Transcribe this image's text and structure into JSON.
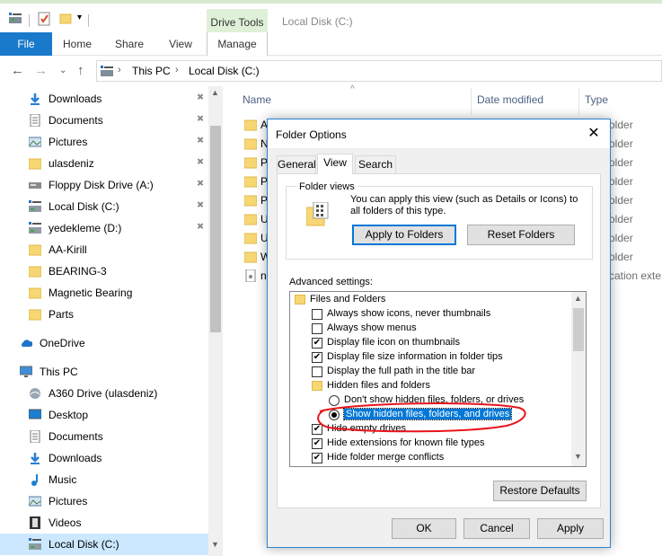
{
  "ribbon": {
    "context_group": "Drive Tools",
    "window_title": "Local Disk (C:)",
    "tabs": [
      "File",
      "Home",
      "Share",
      "View",
      "Manage"
    ]
  },
  "address": {
    "crumbs": [
      "This PC",
      "Local Disk (C:)"
    ]
  },
  "sidebar": {
    "items": [
      {
        "label": "Downloads",
        "icon": "download-arrow-icon",
        "pinned": true
      },
      {
        "label": "Documents",
        "icon": "documents-icon",
        "pinned": true
      },
      {
        "label": "Pictures",
        "icon": "pictures-icon",
        "pinned": true
      },
      {
        "label": "ulasdeniz",
        "icon": "folder-icon",
        "pinned": true
      },
      {
        "label": "Floppy Disk Drive (A:)",
        "icon": "floppy-icon",
        "pinned": true
      },
      {
        "label": "Local Disk (C:)",
        "icon": "drive-icon",
        "pinned": true
      },
      {
        "label": "yedekleme (D:)",
        "icon": "drive-icon",
        "pinned": true
      },
      {
        "label": "AA-Kirill",
        "icon": "folder-icon",
        "pinned": false
      },
      {
        "label": "BEARING-3",
        "icon": "folder-icon",
        "pinned": false
      },
      {
        "label": "Magnetic Bearing",
        "icon": "folder-icon",
        "pinned": false
      },
      {
        "label": "Parts",
        "icon": "folder-icon",
        "pinned": false
      },
      {
        "label": "OneDrive",
        "icon": "cloud-icon",
        "pinned": false
      },
      {
        "label": "This PC",
        "icon": "computer-icon",
        "pinned": false
      },
      {
        "label": "A360 Drive (ulasdeniz)",
        "icon": "a360-icon",
        "pinned": false
      },
      {
        "label": "Desktop",
        "icon": "desktop-icon",
        "pinned": false
      },
      {
        "label": "Documents",
        "icon": "documents-icon",
        "pinned": false
      },
      {
        "label": "Downloads",
        "icon": "download-arrow-icon",
        "pinned": false
      },
      {
        "label": "Music",
        "icon": "music-icon",
        "pinned": false
      },
      {
        "label": "Pictures",
        "icon": "pictures-icon",
        "pinned": false
      },
      {
        "label": "Videos",
        "icon": "videos-icon",
        "pinned": false
      },
      {
        "label": "Local Disk (C:)",
        "icon": "drive-icon",
        "pinned": false,
        "selected": true
      }
    ]
  },
  "content": {
    "columns": [
      "Name",
      "Date modified",
      "Type"
    ],
    "rows": [
      {
        "name": "A",
        "type": "older"
      },
      {
        "name": "N",
        "type": "older"
      },
      {
        "name": "P",
        "type": "older"
      },
      {
        "name": "P",
        "type": "older"
      },
      {
        "name": "P",
        "type": "older"
      },
      {
        "name": "U",
        "type": "older"
      },
      {
        "name": "U",
        "type": "older"
      },
      {
        "name": "W",
        "type": "older"
      },
      {
        "name": "n",
        "type": "cation exte"
      }
    ]
  },
  "dialog": {
    "title": "Folder Options",
    "tabs": [
      "General",
      "View",
      "Search"
    ],
    "folder_views": {
      "legend": "Folder views",
      "text": "You can apply this view (such as Details or Icons) to all folders of this type.",
      "apply_button": "Apply to Folders",
      "reset_button": "Reset Folders"
    },
    "advanced_label": "Advanced settings:",
    "advanced": [
      {
        "kind": "folder",
        "label": "Files and Folders"
      },
      {
        "kind": "check",
        "label": "Always show icons, never thumbnails",
        "checked": false
      },
      {
        "kind": "check",
        "label": "Always show menus",
        "checked": false
      },
      {
        "kind": "check",
        "label": "Display file icon on thumbnails",
        "checked": true
      },
      {
        "kind": "check",
        "label": "Display file size information in folder tips",
        "checked": true
      },
      {
        "kind": "check",
        "label": "Display the full path in the title bar",
        "checked": false
      },
      {
        "kind": "folder",
        "label": "Hidden files and folders"
      },
      {
        "kind": "radio",
        "label": "Don't show hidden files, folders, or drives",
        "checked": false
      },
      {
        "kind": "radio",
        "label": "Show hidden files, folders, and drives",
        "checked": true,
        "selected": true
      },
      {
        "kind": "check",
        "label": "Hide empty drives",
        "checked": true
      },
      {
        "kind": "check",
        "label": "Hide extensions for known file types",
        "checked": true
      },
      {
        "kind": "check",
        "label": "Hide folder merge conflicts",
        "checked": true
      }
    ],
    "restore_button": "Restore Defaults",
    "ok_button": "OK",
    "cancel_button": "Cancel",
    "apply_button": "Apply"
  },
  "colors": {
    "file_tab": "#1979ca",
    "selection": "#0078d7",
    "annotation": "#e8141b"
  }
}
